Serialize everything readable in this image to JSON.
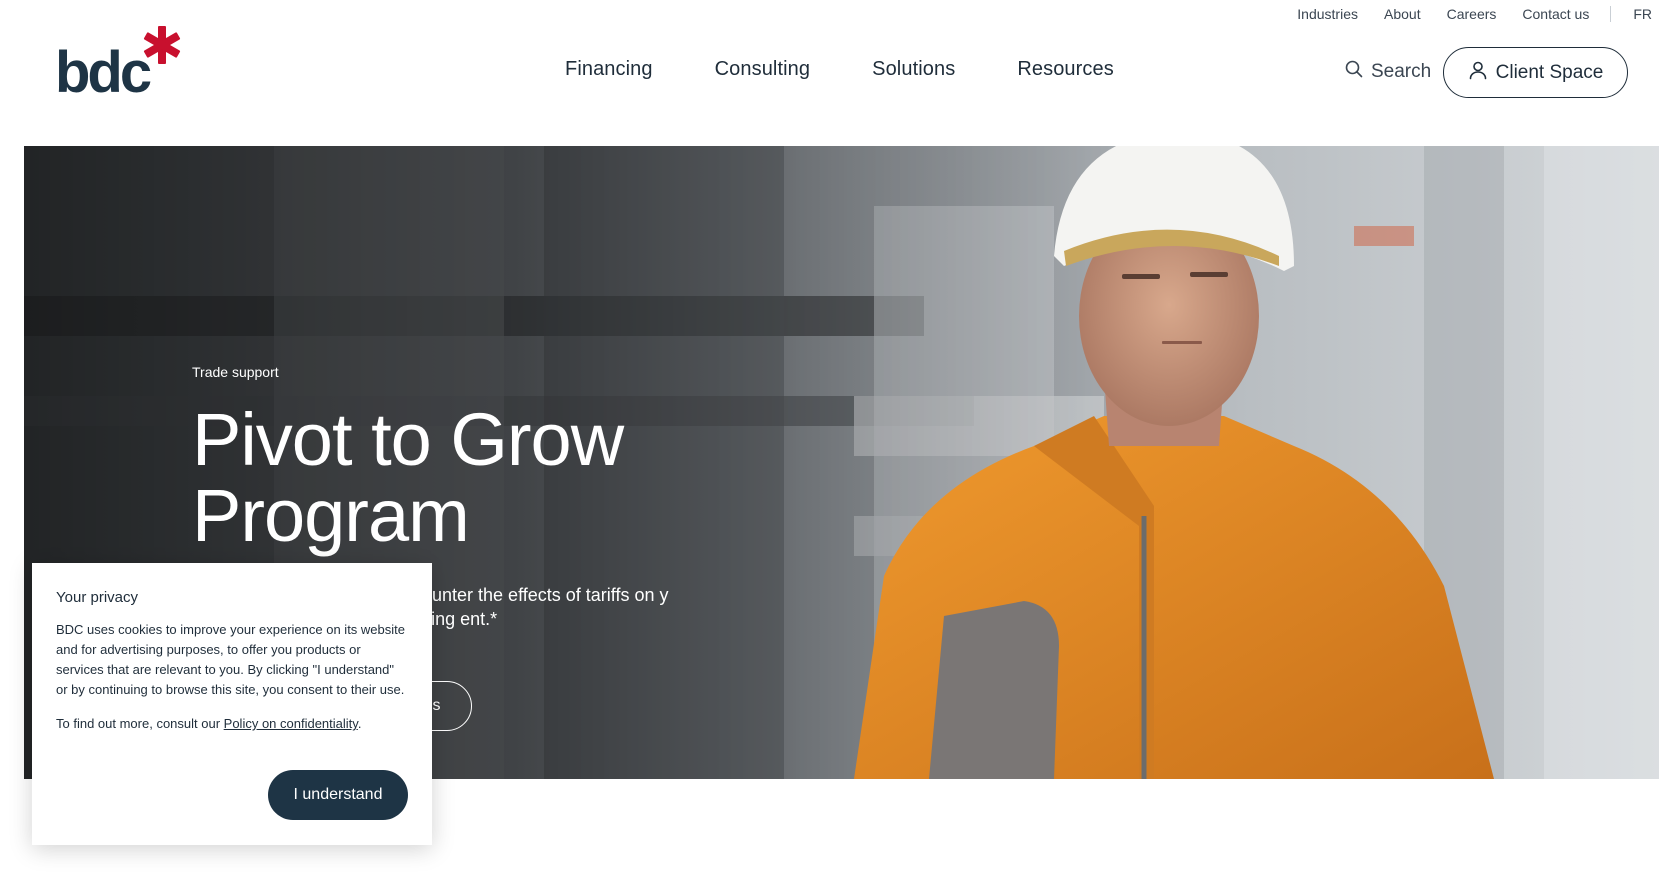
{
  "utility_nav": {
    "items": [
      "Industries",
      "About",
      "Careers",
      "Contact us"
    ],
    "language": "FR"
  },
  "logo": {
    "text": "bdc",
    "accent_color": "#c8102e",
    "text_color": "#1e3445"
  },
  "main_nav": {
    "items": [
      "Financing",
      "Consulting",
      "Solutions",
      "Resources"
    ]
  },
  "search": {
    "label": "Search"
  },
  "client_space": {
    "label": "Client Space"
  },
  "hero": {
    "eyebrow": "Trade support",
    "title": "Pivot to Grow Program",
    "description": "unter the effects of tariffs on y preserving cash flow, diversifying ent.*",
    "cta_label": "ns"
  },
  "cookie_banner": {
    "title": "Your privacy",
    "body": "BDC uses cookies to improve your experience on its website and for advertising purposes, to offer you products or services that are relevant to you. By clicking \"I understand\" or by continuing to browse this site, you consent to their use.",
    "more_prefix": "To find out more, consult our ",
    "policy_link": "Policy on confidentiality",
    "more_suffix": ".",
    "button_label": "I understand"
  },
  "colors": {
    "brand_navy": "#1e3445",
    "brand_red": "#c8102e",
    "jacket_orange": "#e8891f"
  }
}
